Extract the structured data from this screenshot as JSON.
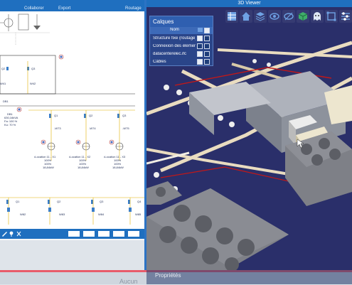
{
  "ribbon": {
    "tabs": [
      "Collaborer",
      "Export",
      "Routage"
    ]
  },
  "viewer": {
    "title": "3D Viewer",
    "toolbar_icons": [
      "grid-icon",
      "home-icon",
      "layers-icon",
      "eye-icon",
      "eye-alt-icon",
      "cube-icon",
      "ghost-icon",
      "select-icon",
      "sliders-icon"
    ]
  },
  "layers": {
    "title": "Calques",
    "column_name": "Nom",
    "rows": [
      {
        "name": "Structure fixe (routage)",
        "checked": true
      },
      {
        "name": "Connexion des éléments",
        "checked": false
      },
      {
        "name": "datacenterelec.ifc",
        "checked": true
      },
      {
        "name": "Câbles",
        "checked": true
      }
    ]
  },
  "schematic": {
    "breakers_top": [
      "Q2",
      "Q3"
    ],
    "wires_top": [
      "W41",
      "W42"
    ],
    "db": {
      "name": "DB1",
      "rating": "630,16kVA",
      "load": "Fa: 100 %",
      "ku": "Ku: 70 %"
    },
    "feeders": [
      {
        "breaker": "Q1",
        "wire": "-W73",
        "location": "•Location 11 - X1",
        "pct1": "100%",
        "pct2": "100%",
        "power": "18,84kW"
      },
      {
        "breaker": "Q2",
        "wire": "-W74",
        "location": "•Location 11 - X2",
        "pct1": "100%",
        "pct2": "100%",
        "power": "18,84kW"
      },
      {
        "breaker": "Q3",
        "wire": "-W75",
        "location": "•Location 11 - X3",
        "pct1": "100%",
        "pct2": "100%",
        "power": "18,84kW"
      }
    ],
    "bottom_breakers": [
      "Q1",
      "Q2",
      "Q3",
      "Q4"
    ],
    "bottom_wires": [
      "W82",
      "W83",
      "W84",
      "W85"
    ]
  },
  "properties": {
    "title": "Propriétés",
    "empty": "Aucun"
  },
  "colors": {
    "ribbon": "#1f6fbf",
    "viewer_bg": "#2a2f6a",
    "accent_red": "#e85c6b"
  }
}
